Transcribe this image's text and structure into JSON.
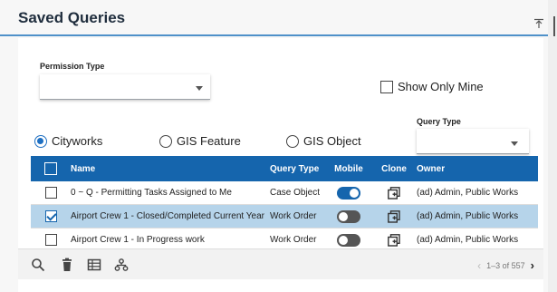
{
  "panel": {
    "title": "Saved Queries",
    "collapse_icon": "collapse-top-icon"
  },
  "filters": {
    "permission_type_label": "Permission Type",
    "permission_type_value": "",
    "show_only_mine_label": "Show Only Mine",
    "show_only_mine_checked": false,
    "query_type_label": "Query Type",
    "query_type_value": ""
  },
  "source_radios": [
    {
      "label": "Cityworks",
      "selected": true
    },
    {
      "label": "GIS Feature",
      "selected": false
    },
    {
      "label": "GIS Object",
      "selected": false
    }
  ],
  "table": {
    "headers": {
      "name": "Name",
      "query_type": "Query Type",
      "mobile": "Mobile",
      "clone": "Clone",
      "owner": "Owner"
    },
    "rows": [
      {
        "name": "0 ~ Q - Permitting Tasks Assigned to Me",
        "query_type": "Case Object",
        "mobile": true,
        "selected": false,
        "owner": "(ad) Admin, Public Works"
      },
      {
        "name": "Airport Crew 1 - Closed/Completed Current Year",
        "query_type": "Work Order",
        "mobile": false,
        "selected": true,
        "owner": "(ad) Admin, Public Works"
      },
      {
        "name": "Airport Crew 1 - In Progress work",
        "query_type": "Work Order",
        "mobile": false,
        "selected": false,
        "owner": "(ad) Admin, Public Works"
      }
    ]
  },
  "footer": {
    "tools": [
      "search-icon",
      "trash-icon",
      "grid-icon",
      "hierarchy-icon"
    ],
    "paging_text": "1–3 of 557"
  },
  "colors": {
    "accent": "#1565ad",
    "selected_row": "#b6d4ea",
    "header_rule": "#4f91c9"
  }
}
